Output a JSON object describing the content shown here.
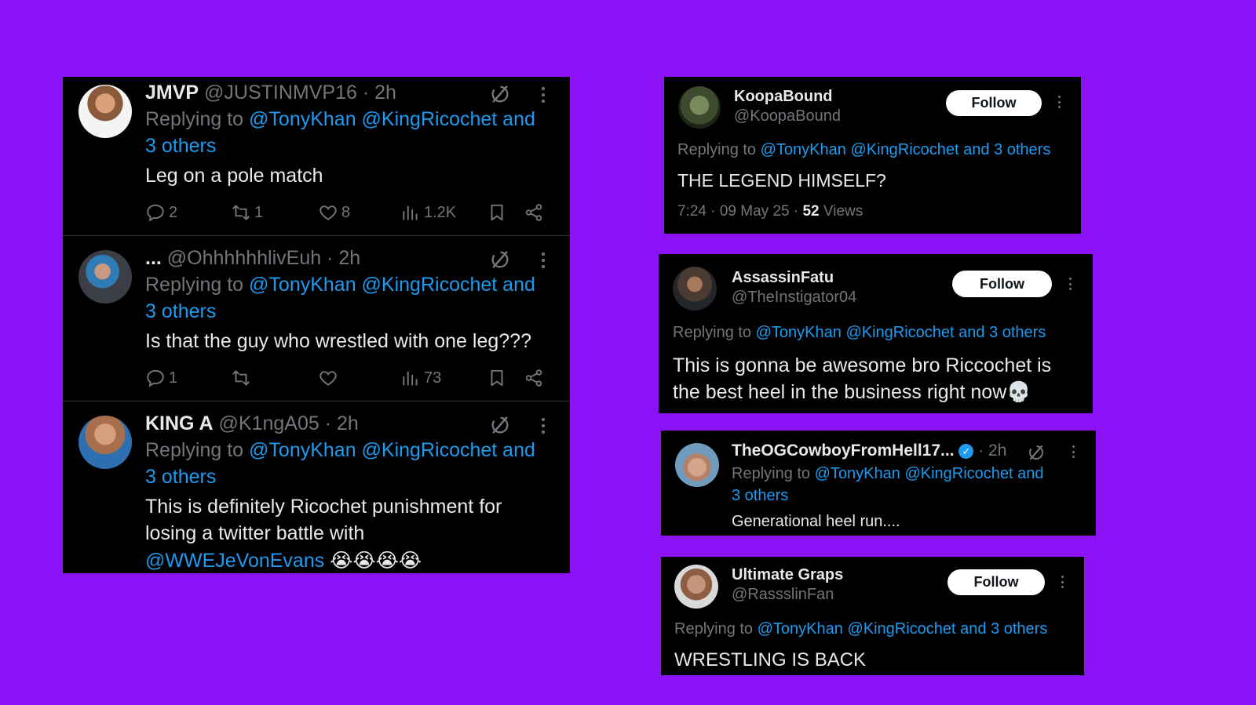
{
  "colors": {
    "background": "#8b12f7",
    "panel": "#000000",
    "link": "#1d9bf0",
    "muted": "#71767b",
    "text": "#e7e9ea",
    "verified": "#1d9bf0"
  },
  "left_panel": {
    "tweets": [
      {
        "display_name": "JMVP",
        "handle": "@JUSTINMVP16",
        "time": "· 2h",
        "replying_prefix": "Replying to",
        "replying_line1": "@TonyKhan @KingRicochet and",
        "replying_line2": "3 others",
        "text": "Leg on a pole match",
        "replies": "2",
        "reposts": "1",
        "likes": "8",
        "views": "1.2K"
      },
      {
        "display_name": "...",
        "handle": "@OhhhhhhlivEuh",
        "time": "· 2h",
        "replying_prefix": "Replying to",
        "replying_line1": "@TonyKhan @KingRicochet and",
        "replying_line2": "3 others",
        "text": "Is that the guy who wrestled with one leg???",
        "replies": "1",
        "reposts": "",
        "likes": "",
        "views": "73"
      },
      {
        "display_name": "KING A",
        "handle": "@K1ngA05",
        "time": "· 2h",
        "replying_prefix": "Replying to",
        "replying_line1": "@TonyKhan @KingRicochet and",
        "replying_line2": "3 others",
        "text_line1": "This is definitely Ricochet punishment for",
        "text_line2": "losing a twitter battle with",
        "text_mention": "@WWEJeVonEvans",
        "text_emoji": "😭😭😭😭"
      }
    ]
  },
  "right_panels": [
    {
      "display_name": "KoopaBound",
      "handle": "@KoopaBound",
      "follow_label": "Follow",
      "replying_prefix": "Replying to",
      "replying_mentions": "@TonyKhan @KingRicochet and 3 others",
      "text": "THE LEGEND HIMSELF?",
      "meta_time": "7:24 · 09 May 25 ·",
      "views_count": "52",
      "views_label": "Views"
    },
    {
      "display_name": "AssassinFatu",
      "handle": "@TheInstigator04",
      "follow_label": "Follow",
      "replying_prefix": "Replying to",
      "replying_mentions": "@TonyKhan @KingRicochet and 3 others",
      "text_line1": "This is gonna be awesome bro Riccochet is",
      "text_line2": "the best heel in the business right now",
      "text_emoji": "💀"
    },
    {
      "display_name": "TheOGCowboyFromHell17...",
      "time": "· 2h",
      "replying_prefix": "Replying to",
      "replying_line1": "@TonyKhan @KingRicochet and",
      "replying_line2": "3 others",
      "text": "Generational heel run...."
    },
    {
      "display_name": "Ultimate Graps",
      "handle": "@RassslinFan",
      "follow_label": "Follow",
      "replying_prefix": "Replying to",
      "replying_mentions": "@TonyKhan @KingRicochet and 3 others",
      "text": "WRESTLING IS BACK"
    }
  ],
  "icons": {
    "reply": "reply-icon",
    "repost": "repost-icon",
    "like": "heart-icon",
    "views": "views-icon",
    "bookmark": "bookmark-icon",
    "share": "share-icon",
    "more": "more-icon",
    "grok": "grok-icon",
    "verified": "verified-badge-icon"
  }
}
